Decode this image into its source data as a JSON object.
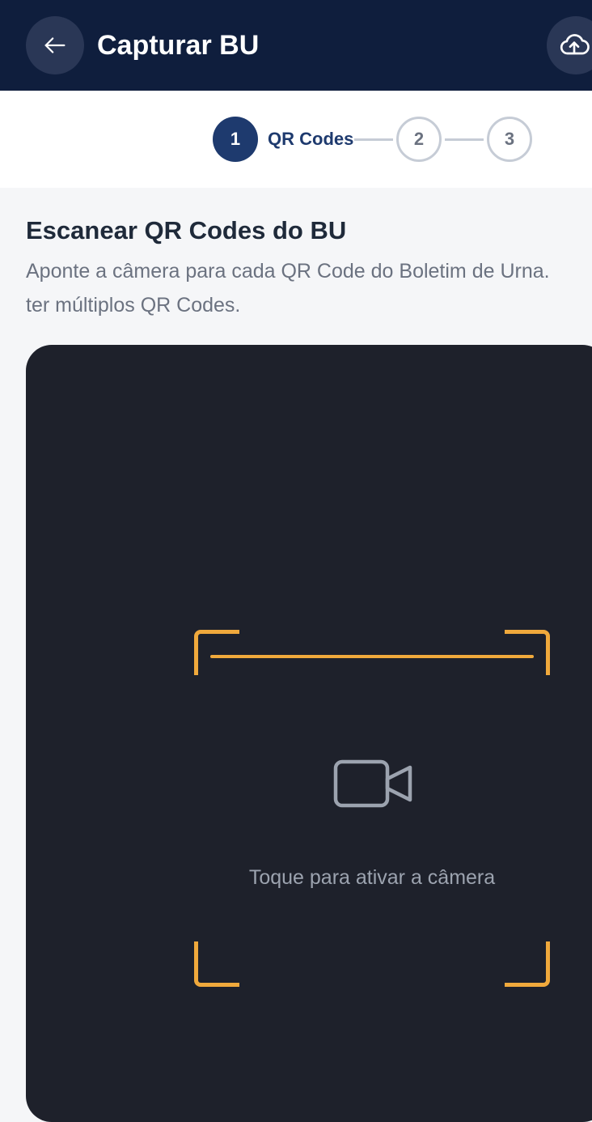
{
  "header": {
    "title": "Capturar BU",
    "back_icon": "arrow-left-icon",
    "upload_icon": "cloud-upload-icon"
  },
  "stepper": {
    "steps": [
      {
        "number": "1",
        "label": "QR Codes",
        "state": "active"
      },
      {
        "number": "2",
        "label": "",
        "state": "inactive"
      },
      {
        "number": "3",
        "label": "",
        "state": "inactive"
      }
    ]
  },
  "main": {
    "title": "Escanear QR Codes do BU",
    "description_line1": "Aponte a câmera para cada QR Code do Boletim de Urna.",
    "description_line2": "ter múltiplos QR Codes."
  },
  "camera": {
    "icon": "video-camera-icon",
    "prompt": "Toque para ativar a câmera"
  },
  "colors": {
    "header_bg": "#0f1e3d",
    "accent": "#1e3a6e",
    "scanner_frame": "#f0a93c",
    "camera_bg": "#1e212b"
  }
}
